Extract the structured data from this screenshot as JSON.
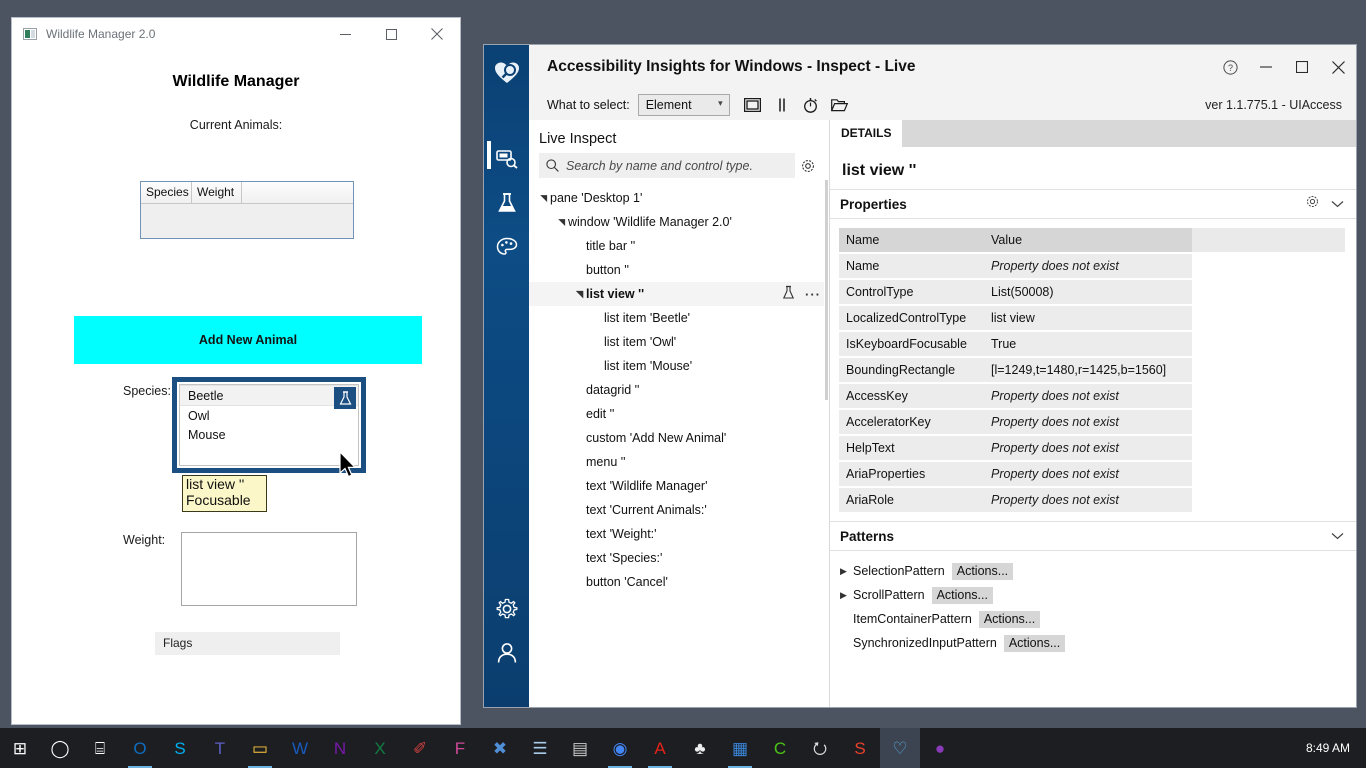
{
  "wildlife": {
    "title": "Wildlife Manager 2.0",
    "heading": "Wildlife Manager",
    "current_animals_label": "Current Animals:",
    "grid_columns": [
      "Species",
      "Weight",
      ""
    ],
    "add_button": "Add New Animal",
    "species_label": "Species:",
    "species_items": [
      "Beetle",
      "Owl",
      "Mouse"
    ],
    "tooltip": {
      "line1": "list view ''",
      "line2": "Focusable"
    },
    "weight_label": "Weight:",
    "weight_value": "",
    "flags_label": "Flags",
    "accent_color": "#00ffff",
    "focus_outline_color": "#1b4f82",
    "minimize": "—",
    "maximize": "□",
    "close": "✕"
  },
  "insights": {
    "title": "Accessibility Insights for Windows - Inspect - Live",
    "version": "ver 1.1.775.1 - UIAccess",
    "titlebar_buttons": {
      "help": "?",
      "minimize": "—",
      "maximize": "□",
      "close": "✕"
    },
    "toolbar": {
      "what_to_select_label": "What to select:",
      "combo_value": "Element",
      "icons": [
        "highlight-icon",
        "pause-icon",
        "timer-icon",
        "open-folder-icon"
      ]
    },
    "rail": {
      "items": [
        "logo-icon",
        "inspect-icon",
        "test-icon",
        "color-contrast-icon",
        "settings-icon",
        "account-icon"
      ]
    },
    "left_panel": {
      "heading": "Live Inspect",
      "search_placeholder": "Search by name and control type.",
      "search_value": "",
      "gear_icon": "gear-icon",
      "tree": [
        {
          "label": "pane 'Desktop 1'",
          "indent": 0,
          "arrow": true,
          "selected": false
        },
        {
          "label": "window 'Wildlife Manager 2.0'",
          "indent": 1,
          "arrow": true,
          "selected": false
        },
        {
          "label": "title bar ''",
          "indent": 2,
          "arrow": false,
          "selected": false
        },
        {
          "label": "button ''",
          "indent": 2,
          "arrow": false,
          "selected": false
        },
        {
          "label": "list view ''",
          "indent": 2,
          "arrow": true,
          "selected": true
        },
        {
          "label": "list item 'Beetle'",
          "indent": 3,
          "arrow": false,
          "selected": false
        },
        {
          "label": "list item 'Owl'",
          "indent": 3,
          "arrow": false,
          "selected": false
        },
        {
          "label": "list item 'Mouse'",
          "indent": 3,
          "arrow": false,
          "selected": false
        },
        {
          "label": "datagrid ''",
          "indent": 2,
          "arrow": false,
          "selected": false
        },
        {
          "label": "edit ''",
          "indent": 2,
          "arrow": false,
          "selected": false
        },
        {
          "label": "custom 'Add New Animal'",
          "indent": 2,
          "arrow": false,
          "selected": false
        },
        {
          "label": "menu ''",
          "indent": 2,
          "arrow": false,
          "selected": false
        },
        {
          "label": "text 'Wildlife Manager'",
          "indent": 2,
          "arrow": false,
          "selected": false
        },
        {
          "label": "text 'Current Animals:'",
          "indent": 2,
          "arrow": false,
          "selected": false
        },
        {
          "label": "text 'Weight:'",
          "indent": 2,
          "arrow": false,
          "selected": false
        },
        {
          "label": "text 'Species:'",
          "indent": 2,
          "arrow": false,
          "selected": false
        },
        {
          "label": "button 'Cancel'",
          "indent": 2,
          "arrow": false,
          "selected": false
        }
      ]
    },
    "details": {
      "tab": "DETAILS",
      "element_name": "list view ''",
      "properties_header": "Properties",
      "columns": [
        "Name",
        "Value"
      ],
      "rows": [
        {
          "name": "Name",
          "value": "Property does not exist",
          "missing": true
        },
        {
          "name": "ControlType",
          "value": "List(50008)",
          "missing": false
        },
        {
          "name": "LocalizedControlType",
          "value": "list view",
          "missing": false
        },
        {
          "name": "IsKeyboardFocusable",
          "value": "True",
          "missing": false
        },
        {
          "name": "BoundingRectangle",
          "value": "[l=1249,t=1480,r=1425,b=1560]",
          "missing": false
        },
        {
          "name": "AccessKey",
          "value": "Property does not exist",
          "missing": true
        },
        {
          "name": "AcceleratorKey",
          "value": "Property does not exist",
          "missing": true
        },
        {
          "name": "HelpText",
          "value": "Property does not exist",
          "missing": true
        },
        {
          "name": "AriaProperties",
          "value": "Property does not exist",
          "missing": true
        },
        {
          "name": "AriaRole",
          "value": "Property does not exist",
          "missing": true
        }
      ],
      "patterns_header": "Patterns",
      "patterns": [
        {
          "name": "SelectionPattern",
          "action": "Actions...",
          "expandable": true
        },
        {
          "name": "ScrollPattern",
          "action": "Actions...",
          "expandable": true
        },
        {
          "name": "ItemContainerPattern",
          "action": "Actions...",
          "expandable": false
        },
        {
          "name": "SynchronizedInputPattern",
          "action": "Actions...",
          "expandable": false
        }
      ]
    }
  },
  "taskbar": {
    "clock": "8:49 AM",
    "items": [
      {
        "name": "start-icon",
        "glyph": "⊞",
        "color": "#ffffff",
        "active": false,
        "underline": false
      },
      {
        "name": "cortana-icon",
        "glyph": "◯",
        "color": "#ffffff",
        "active": false,
        "underline": false
      },
      {
        "name": "task-view-icon",
        "glyph": "⌸",
        "color": "#ffffff",
        "active": false,
        "underline": false
      },
      {
        "name": "outlook-icon",
        "glyph": "O",
        "color": "#0f6cbd",
        "active": false,
        "underline": true
      },
      {
        "name": "skype-icon",
        "glyph": "S",
        "color": "#00aff0",
        "active": false,
        "underline": false
      },
      {
        "name": "teams-icon",
        "glyph": "T",
        "color": "#5b5fc7",
        "active": false,
        "underline": false
      },
      {
        "name": "file-explorer-icon",
        "glyph": "▭",
        "color": "#ffc83d",
        "active": false,
        "underline": true
      },
      {
        "name": "word-icon",
        "glyph": "W",
        "color": "#185abd",
        "active": false,
        "underline": false
      },
      {
        "name": "onenote-icon",
        "glyph": "N",
        "color": "#7719aa",
        "active": false,
        "underline": false
      },
      {
        "name": "excel-icon",
        "glyph": "X",
        "color": "#107c41",
        "active": false,
        "underline": false
      },
      {
        "name": "paint-icon",
        "glyph": "✐",
        "color": "#d04040",
        "active": false,
        "underline": false
      },
      {
        "name": "figma-icon",
        "glyph": "F",
        "color": "#d04a9a",
        "active": false,
        "underline": false
      },
      {
        "name": "app-icon",
        "glyph": "✖",
        "color": "#4f8fd6",
        "active": false,
        "underline": false
      },
      {
        "name": "notepad-icon",
        "glyph": "☰",
        "color": "#a9cbe8",
        "active": false,
        "underline": false
      },
      {
        "name": "calculator-icon",
        "glyph": "▤",
        "color": "#cccccc",
        "active": false,
        "underline": false
      },
      {
        "name": "chrome-icon",
        "glyph": "◉",
        "color": "#4285f4",
        "active": false,
        "underline": true
      },
      {
        "name": "acrobat-icon",
        "glyph": "A",
        "color": "#e2231a",
        "active": false,
        "underline": true
      },
      {
        "name": "solitaire-icon",
        "glyph": "♣",
        "color": "#eeeeee",
        "active": false,
        "underline": false
      },
      {
        "name": "window-app-icon",
        "glyph": "▦",
        "color": "#3a87d8",
        "active": false,
        "underline": true
      },
      {
        "name": "cmd-icon",
        "glyph": "C",
        "color": "#4cc417",
        "active": false,
        "underline": false
      },
      {
        "name": "power-icon",
        "glyph": "⭮",
        "color": "#dddddd",
        "active": false,
        "underline": false
      },
      {
        "name": "snagit-icon",
        "glyph": "S",
        "color": "#e8402a",
        "active": false,
        "underline": false
      },
      {
        "name": "accessibility-insights-icon",
        "glyph": "♡",
        "color": "#5ba8e0",
        "active": true,
        "underline": false
      },
      {
        "name": "browser-icon",
        "glyph": "●",
        "color": "#8a3ab9",
        "active": false,
        "underline": false
      }
    ]
  }
}
